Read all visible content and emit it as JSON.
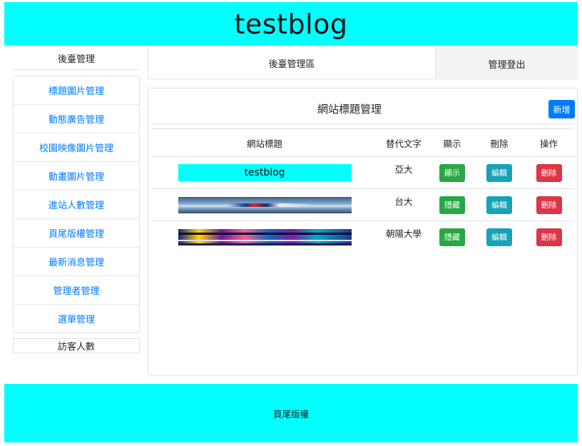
{
  "header": {
    "title": "testblog"
  },
  "sidebar": {
    "heading": "後臺管理",
    "items": [
      {
        "label": "標題圖片管理"
      },
      {
        "label": "動態廣告管理"
      },
      {
        "label": "校園映像圖片管理"
      },
      {
        "label": "動畫圖片管理"
      },
      {
        "label": "進站人數管理"
      },
      {
        "label": "頁尾版權管理"
      },
      {
        "label": "最新消息管理"
      },
      {
        "label": "管理者管理"
      },
      {
        "label": "選單管理"
      }
    ],
    "visitor_label": "訪客人數"
  },
  "topnav": {
    "main_label": "後臺管理區",
    "logout_label": "管理登出"
  },
  "panel": {
    "title": "網站標題管理",
    "add_label": "新增",
    "columns": [
      "網站標題",
      "替代文字",
      "顯示",
      "刪除",
      "操作"
    ],
    "rows": [
      {
        "image_text": "testblog",
        "alt": "亞大",
        "show_label": "顯示",
        "edit_label": "編輯",
        "delete_label": "刪除"
      },
      {
        "image_text": "",
        "alt": "台大",
        "show_label": "隱藏",
        "edit_label": "編輯",
        "delete_label": "刪除"
      },
      {
        "image_text": "",
        "alt": "朝陽大學",
        "show_label": "隱藏",
        "edit_label": "編輯",
        "delete_label": "刪除"
      }
    ]
  },
  "footer": {
    "label": "頁尾版權"
  },
  "colors": {
    "header_bg": "#00ffff",
    "link": "#007bff",
    "btn_add": "#007bff",
    "btn_show": "#28a745",
    "btn_edit": "#17a2b8",
    "btn_delete": "#dc3545"
  }
}
